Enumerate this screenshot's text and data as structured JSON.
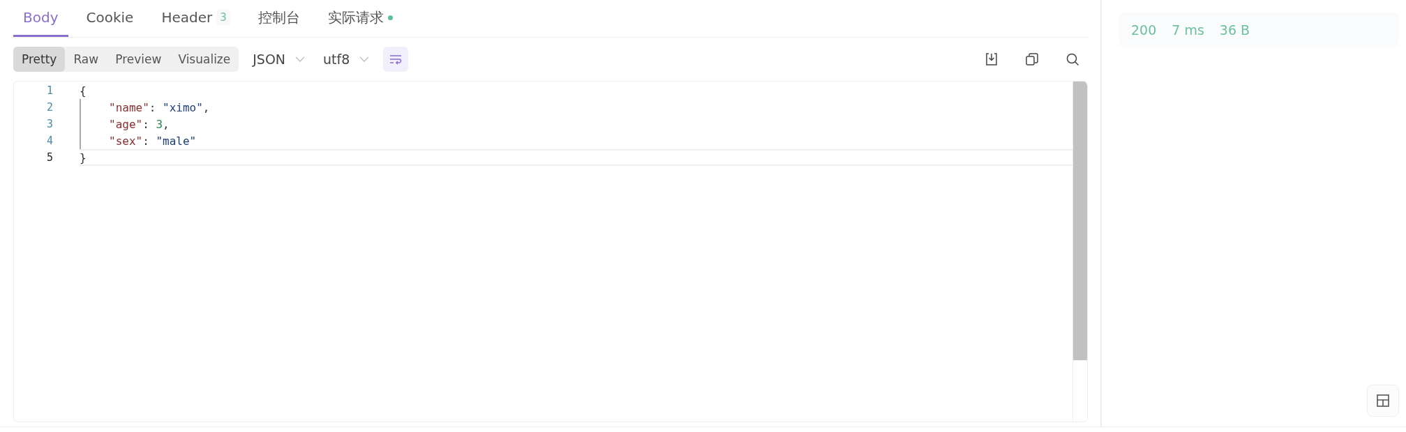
{
  "tabs": [
    {
      "label": "Body",
      "selected": true
    },
    {
      "label": "Cookie",
      "selected": false
    },
    {
      "label": "Header",
      "selected": false,
      "badge": "3"
    },
    {
      "label": "控制台",
      "selected": false
    },
    {
      "label": "实际请求",
      "selected": false,
      "dot": true
    }
  ],
  "view_modes": [
    {
      "label": "Pretty",
      "selected": true
    },
    {
      "label": "Raw",
      "selected": false
    },
    {
      "label": "Preview",
      "selected": false
    },
    {
      "label": "Visualize",
      "selected": false
    }
  ],
  "selects": [
    {
      "value": "JSON"
    },
    {
      "value": "utf8"
    }
  ],
  "wrap_toggle": {
    "on": true
  },
  "code": {
    "lines": [
      {
        "number": "1",
        "active": false,
        "tokens": [
          {
            "kind": "punct",
            "text": "{"
          }
        ],
        "children": [
          {
            "number": "2",
            "active": false,
            "tokens": [
              {
                "kind": "key",
                "text": "\"name\""
              },
              {
                "kind": "punct",
                "text": ": "
              },
              {
                "kind": "string",
                "text": "\"ximo\""
              },
              {
                "kind": "punct",
                "text": ","
              }
            ]
          },
          {
            "number": "3",
            "active": false,
            "tokens": [
              {
                "kind": "key",
                "text": "\"age\""
              },
              {
                "kind": "punct",
                "text": ": "
              },
              {
                "kind": "number",
                "text": "3"
              },
              {
                "kind": "punct",
                "text": ","
              }
            ]
          },
          {
            "number": "4",
            "active": false,
            "tokens": [
              {
                "kind": "key",
                "text": "\"sex\""
              },
              {
                "kind": "punct",
                "text": ": "
              },
              {
                "kind": "string",
                "text": "\"male\""
              }
            ]
          }
        ]
      },
      {
        "number": "5",
        "active": true,
        "tokens": [
          {
            "kind": "punct",
            "text": "}"
          }
        ]
      }
    ]
  },
  "status": {
    "code": "200",
    "time": "7 ms",
    "size": "36 B"
  }
}
